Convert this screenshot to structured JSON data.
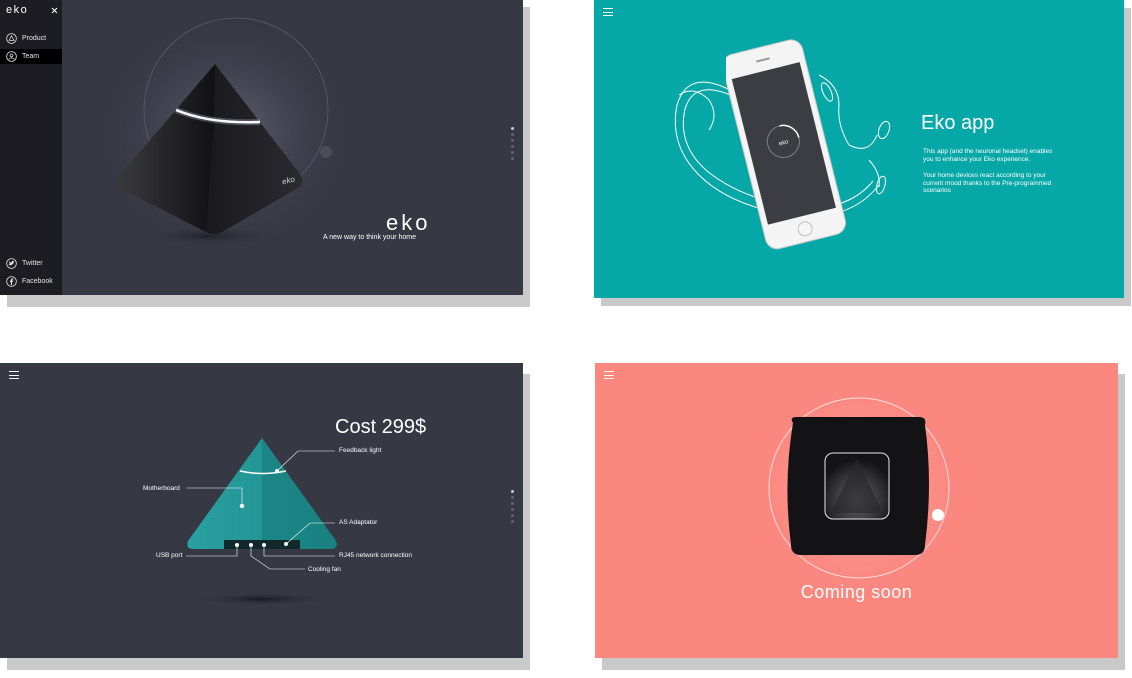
{
  "panel1": {
    "logo": "eko",
    "close_icon": "close-icon",
    "nav": [
      {
        "label": "Product",
        "icon": "triangle-circle-icon"
      },
      {
        "label": "Team",
        "icon": "person-circle-icon"
      }
    ],
    "social": [
      {
        "label": "Twitter",
        "icon": "twitter-icon"
      },
      {
        "label": "Facebook",
        "icon": "facebook-icon"
      }
    ],
    "product_logo": "eko",
    "device_label": "eko",
    "tagline": "A new way to think your home",
    "page_dots": 6,
    "active_dot": 0
  },
  "panel2": {
    "title": "Eko app",
    "paragraph1": "This app (and the neuronal headset) enables you to enhance your Eko experience.",
    "paragraph2": "Your home devices react according to your current mood thanks to the Pre-programmed scenarios"
  },
  "panel3": {
    "price": "Cost 299$",
    "labels": {
      "feedback": "Feedback light",
      "motherboard": "Motherboard",
      "adaptator": "AS Adaptator",
      "usb": "USB port",
      "rj45": "RJ45 network connection",
      "fan": "Cooling fan"
    },
    "page_dots": 6,
    "active_dot": 0
  },
  "panel4": {
    "status": "Coming soon"
  },
  "colors": {
    "dark_panel": "#363944",
    "teal_panel": "#05a8a6",
    "coral_panel": "#fb877f",
    "pyramid_teal": "#1f8b8c"
  }
}
